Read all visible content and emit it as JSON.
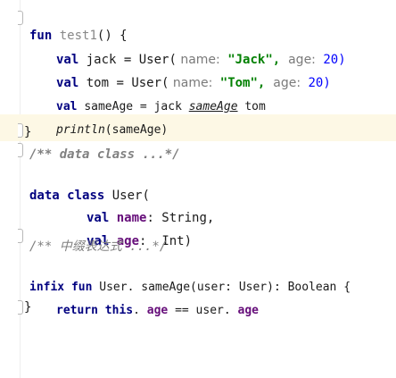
{
  "code": {
    "l1": {
      "kw": "fun",
      "name": "test1",
      "rest": "() {"
    },
    "l2": {
      "kw": "val",
      "var": "jack",
      "eq": " = User(",
      "h1": " name:",
      "s1": " \"Jack\",",
      "h2": "  age:",
      "n": " 20)"
    },
    "l3": {
      "kw": "val",
      "var": "tom",
      "eq": " = User(",
      "h1": " name:",
      "s1": " \"Tom\",",
      "h2": "  age:",
      "n": " 20)"
    },
    "l4": {
      "kw": "val",
      "var": "sameAge",
      "eq": " = jack ",
      "call": "sameAge",
      "tail": " tom"
    },
    "l5": {
      "fn": "println",
      "tail": "(sameAge)"
    },
    "l6": {
      "brace": "}"
    },
    "l7": {
      "comment": "/** data class ...*/"
    },
    "l8": {
      "kw1": "data",
      "kw2": "class",
      "rest": "User("
    },
    "l9": {
      "kw": "val",
      "field": "name",
      "rest": ": String,"
    },
    "l10": {
      "kw": "val",
      "field": "age",
      "rest": ":  Int)"
    },
    "l11": {
      "comment": "/** 中缀表达式 ...*/"
    },
    "l12": {
      "kw1": "infix",
      "kw2": "fun",
      "rest": "User. sameAge(user: User): Boolean {"
    },
    "l13": {
      "kw1": "return",
      "kw2": "this",
      "f1": "age",
      "mid": " == user. ",
      "f2": "age"
    },
    "l14": {
      "brace": "}"
    }
  }
}
